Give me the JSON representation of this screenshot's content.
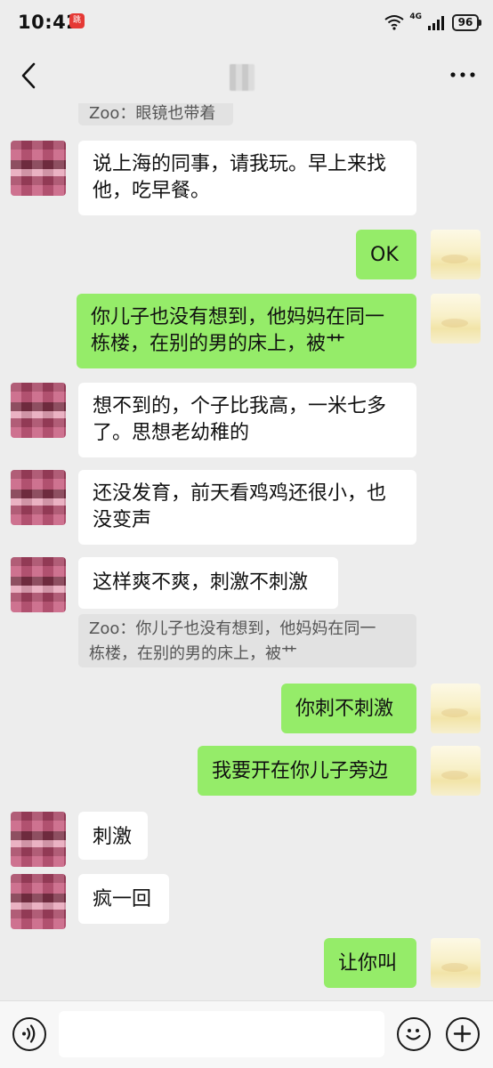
{
  "status_bar": {
    "time": "10:42",
    "app_badge": "跳",
    "network": "4G",
    "battery": "96"
  },
  "nav": {
    "back_icon": "chevron-left-icon",
    "more_icon": "more-dots-icon"
  },
  "messages": [
    {
      "side": "quote",
      "text": "Zoo：眼镜也带着"
    },
    {
      "side": "left",
      "line1": "说上海的同事，请我玩。早上来找",
      "line2": "他，吃早餐。"
    },
    {
      "side": "right",
      "text": "OK"
    },
    {
      "side": "right",
      "line1": "你儿子也没有想到，他妈妈在同一",
      "line2": "栋楼，在别的男的床上，被艹"
    },
    {
      "side": "left",
      "line1": "想不到的，个子比我高，一米七多",
      "line2": "了。思想老幼稚的"
    },
    {
      "side": "left",
      "line1": "还没发育，前天看鸡鸡还很小，也",
      "line2": "没变声"
    },
    {
      "side": "left",
      "text": "这样爽不爽，刺激不刺激"
    },
    {
      "side": "quote",
      "line1": "Zoo：你儿子也没有想到，他妈妈在同一",
      "line2": "栋楼，在别的男的床上，被艹"
    },
    {
      "side": "right",
      "text": "你刺不刺激"
    },
    {
      "side": "right",
      "text": "我要开在你儿子旁边"
    },
    {
      "side": "left",
      "text": "刺激"
    },
    {
      "side": "left",
      "text": "疯一回"
    },
    {
      "side": "right",
      "text": "让你叫"
    }
  ],
  "input_bar": {
    "voice_icon": "voice-icon",
    "emoji_icon": "emoji-icon",
    "plus_icon": "plus-icon",
    "placeholder": ""
  },
  "colors": {
    "background": "#ededed",
    "bubble_sent": "#95ec69",
    "bubble_received": "#ffffff",
    "quote_bg": "#e2e2e2"
  }
}
